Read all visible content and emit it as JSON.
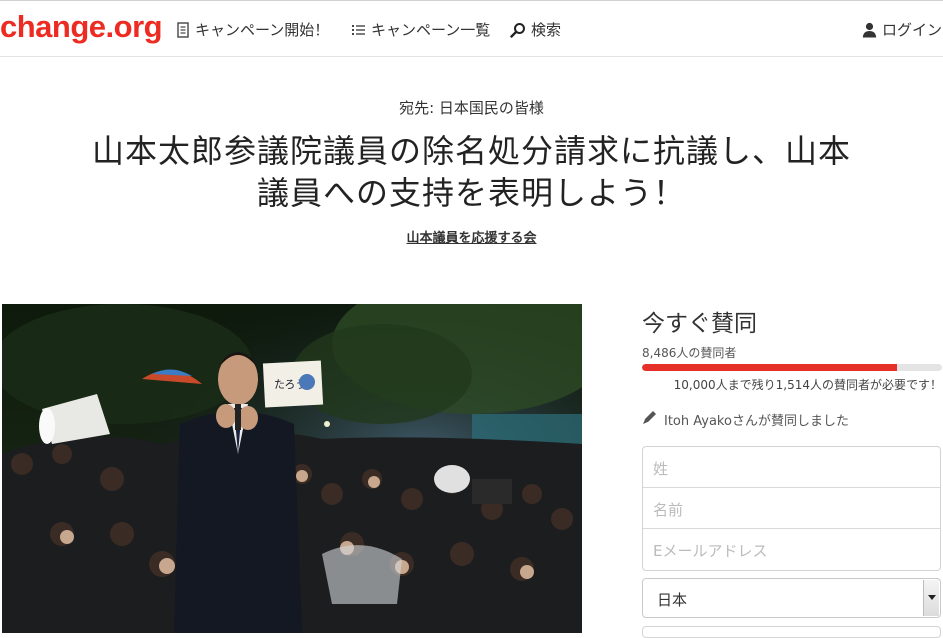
{
  "header": {
    "logo": "change.org",
    "nav": {
      "start_campaign": "キャンペーン開始！",
      "campaign_list": "キャンペーン一覧",
      "search": "検索",
      "login": "ログイン"
    }
  },
  "petition": {
    "recipient": "宛先: 日本国民の皆様",
    "title": "山本太郎参議院議員の除名処分請求に抗議し、山本議員への支持を表明しよう！",
    "starter": "山本議員を応援する会",
    "photo_sign_text": "たろう"
  },
  "sign_panel": {
    "heading": "今すぐ賛同",
    "signers_text": "8,486人の賛同者",
    "signers_count": 8486,
    "goal": 10000,
    "progress_fraction": 0.8486,
    "goal_text": "10,000人まで残り1,514人の賛同者が必要です！",
    "recent_signer": "Itoh Ayakoさんが賛同しました",
    "form": {
      "last_name_placeholder": "姓",
      "first_name_placeholder": "名前",
      "email_placeholder": "Eメールアドレス"
    },
    "country_selected": "日本"
  },
  "colors": {
    "brand": "#ec2c22",
    "progress": "#e5312a",
    "text": "#333333"
  }
}
